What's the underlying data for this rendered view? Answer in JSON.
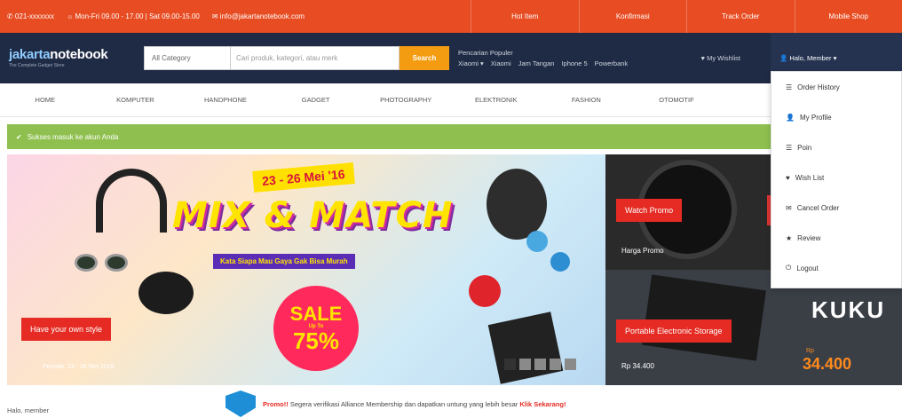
{
  "topbar": {
    "phone": "✆ 021-xxxxxxx",
    "hours": "☼ Mon-Fri 09.00 - 17.00 | Sat 09.00-15.00",
    "email": "✉ info@jakartanotebook.com",
    "links": [
      "Hot Item",
      "Konfirmasi",
      "Track Order",
      "Mobile Shop"
    ]
  },
  "header": {
    "logo_main": "jakarta",
    "logo_accent": "notebook",
    "logo_tagline": "The Complete Gadget Store",
    "search_category": "All Category",
    "search_placeholder": "Cari produk, kategori, atau merk",
    "search_button": "Search",
    "popular_title": "Pencarian Populer",
    "popular_items": [
      "Xiaomi ▾",
      "Xiaomi",
      "Jam Tangan",
      "Iphone 5",
      "Powerbank"
    ],
    "wishlist": "♥ My Wishlist",
    "user": "👤 Halo, Member ▾"
  },
  "nav": [
    "Home",
    "Komputer",
    "Handphone",
    "Gadget",
    "Photography",
    "Elektronik",
    "Fashion",
    "Otomotif"
  ],
  "alert": "Sukses masuk ke akun Anda",
  "banner": {
    "date": "23 - 26 Mei '16",
    "title": "MIX & MATCH",
    "tagline": "Kata Siapa Mau Gaya Gak Bisa Murah",
    "sale_word": "SALE",
    "sale_upto": "Up To",
    "sale_pct": "75%",
    "label": "Have your own style",
    "caption": "Periode: 23 - 26 Mei 2016"
  },
  "side1": {
    "label": "Watch Promo",
    "sub": "Harga Promo"
  },
  "side2": {
    "label": "Portable Electronic Storage",
    "sub": "Rp 34.400",
    "brand": "KUKU",
    "price_rp": "Rp",
    "price": "34.400"
  },
  "dropdown": [
    {
      "icon": "☰",
      "label": "Order History"
    },
    {
      "icon": "👤",
      "label": "My Profile"
    },
    {
      "icon": "☰",
      "label": "Poin"
    },
    {
      "icon": "♥",
      "label": "Wish List"
    },
    {
      "icon": "✉",
      "label": "Cancel Order"
    },
    {
      "icon": "★",
      "label": "Review"
    },
    {
      "icon": "⏻",
      "label": "Logout"
    }
  ],
  "bottom": {
    "welcome": "Halo, member",
    "promo_prefix": "Promo!!",
    "promo_text": "Segera verifikasi Alliance Membership dan dapatkan untung yang lebih besar",
    "promo_link": "Klik Sekarang!"
  }
}
